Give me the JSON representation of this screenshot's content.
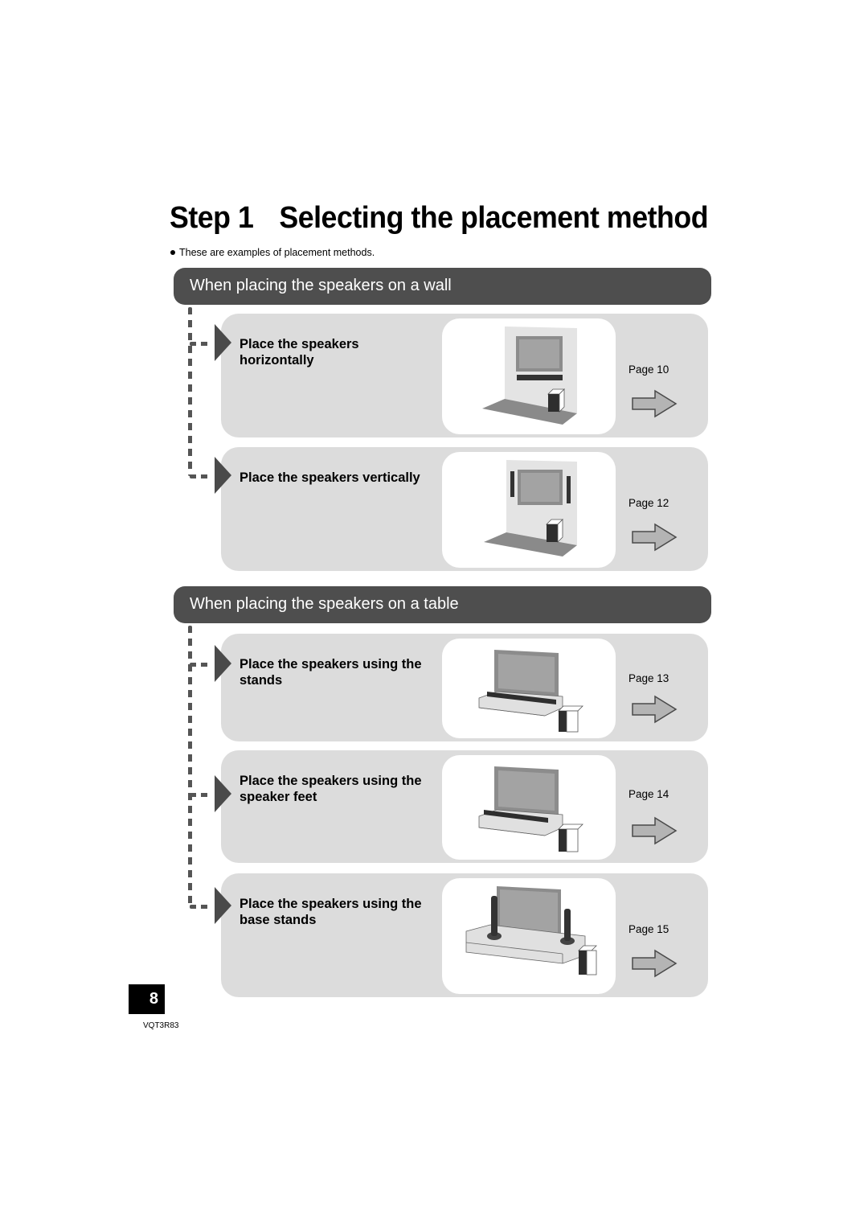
{
  "page": {
    "title_step": "Step 1",
    "title_text": "Selecting the placement method",
    "note": "These are examples of placement methods.",
    "page_number": "8",
    "doc_code": "VQT3R83"
  },
  "sections": [
    {
      "heading": "When placing the speakers on a wall",
      "items": [
        {
          "label": "Place the speakers horizontally",
          "page_ref": "Page 10",
          "illustration": "wall-horizontal-speaker-illustration"
        },
        {
          "label": "Place the speakers vertically",
          "page_ref": "Page 12",
          "illustration": "wall-vertical-speakers-illustration"
        }
      ]
    },
    {
      "heading": "When placing the speakers on a table",
      "items": [
        {
          "label": "Place the speakers using the stands",
          "page_ref": "Page 13",
          "illustration": "table-stands-illustration"
        },
        {
          "label": "Place the speakers using the speaker feet",
          "page_ref": "Page 14",
          "illustration": "table-speaker-feet-illustration"
        },
        {
          "label": "Place the speakers using the base stands",
          "page_ref": "Page 15",
          "illustration": "table-base-stands-illustration"
        }
      ]
    }
  ],
  "colors": {
    "section_bar": "#4e4e4e",
    "card_bg": "#dcdcdc",
    "arrow_fill": "#b4b4b4",
    "arrow_stroke": "#4a4a4a"
  }
}
